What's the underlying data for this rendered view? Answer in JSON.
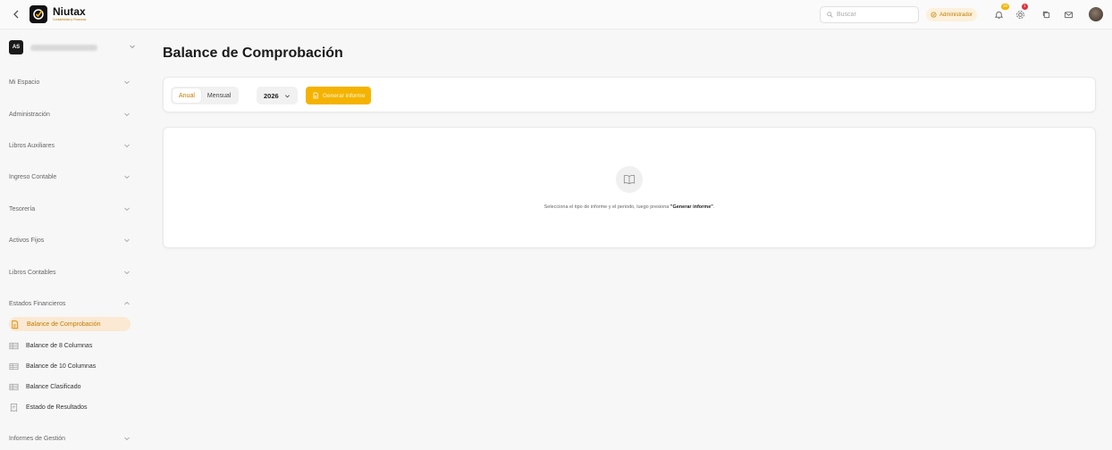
{
  "brand": {
    "name": "Niutax",
    "tagline": "Contabilidad y Finanzas"
  },
  "topbar": {
    "search_placeholder": "Buscar",
    "role": "Administrador",
    "notifications_count": "30",
    "alerts_count": "1"
  },
  "org": {
    "initials": "AS"
  },
  "sidebar": {
    "sections": [
      {
        "label": "Mi Espacio"
      },
      {
        "label": "Administración"
      },
      {
        "label": "Libros Auxiliares"
      },
      {
        "label": "Ingreso Contable"
      },
      {
        "label": "Tesorería"
      },
      {
        "label": "Activos Fijos"
      },
      {
        "label": "Libros Contables"
      },
      {
        "label": "Estados Financieros"
      }
    ],
    "sub_items": [
      {
        "label": "Balance de Comprobación"
      },
      {
        "label": "Balance de 8 Columnas"
      },
      {
        "label": "Balance de 10 Columnas"
      },
      {
        "label": "Balance Clasificado"
      },
      {
        "label": "Estado de Resultados"
      }
    ],
    "last_section": "Informes de Gestión"
  },
  "page": {
    "title": "Balance de Comprobación"
  },
  "filters": {
    "period_options": [
      "Anual",
      "Mensual"
    ],
    "selected_period": "Anual",
    "year": "2026",
    "generate_label": "Generar informe"
  },
  "empty_state": {
    "text_before": "Selecciona el tipo de informe y el periodo, luego presiona ",
    "emphasis": "\"Generar informe\"",
    "text_after": "."
  },
  "colors": {
    "accent": "#f5b301",
    "accent_text": "#c07a00",
    "active_bg": "#fbe9d3"
  }
}
